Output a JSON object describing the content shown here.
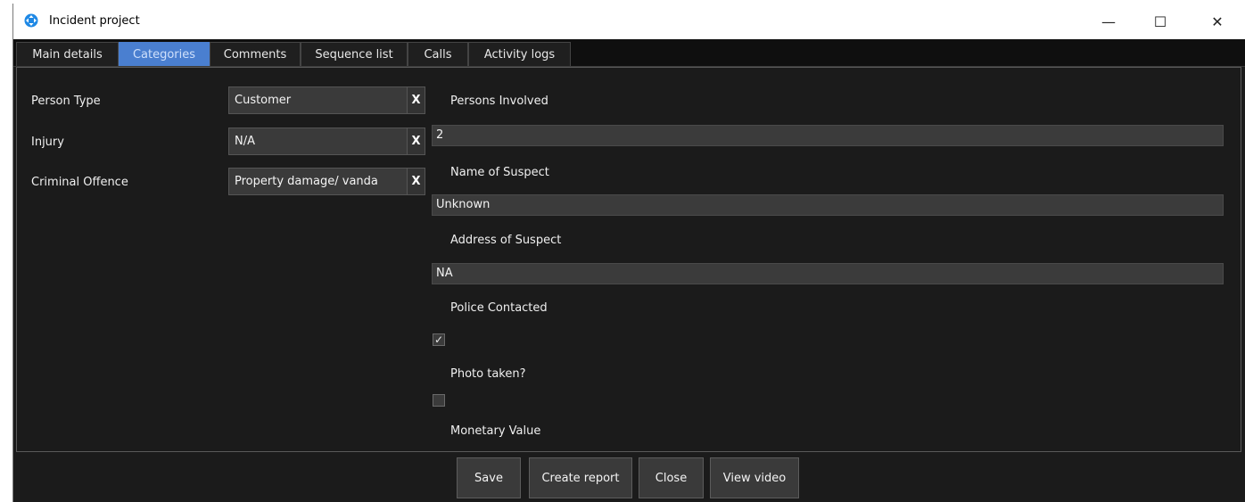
{
  "window": {
    "title": "Incident project",
    "minimize_glyph": "—",
    "maximize_glyph": "☐",
    "close_glyph": "✕",
    "icon": "app-logo-icon",
    "accent": "#4a7fd0"
  },
  "tabs": [
    {
      "label": "Main details",
      "active": false
    },
    {
      "label": "Categories",
      "active": true
    },
    {
      "label": "Comments",
      "active": false
    },
    {
      "label": "Sequence list",
      "active": false
    },
    {
      "label": "Calls",
      "active": false
    },
    {
      "label": "Activity logs",
      "active": false
    }
  ],
  "categories": [
    {
      "label": "Person Type",
      "value": "Customer",
      "clear": "X"
    },
    {
      "label": "Injury",
      "value": "N/A",
      "clear": "X"
    },
    {
      "label": "Criminal Offence",
      "value": "Property damage/ vanda",
      "clear": "X"
    }
  ],
  "fields": {
    "persons_involved": {
      "label": "Persons Involved",
      "value": "2"
    },
    "name_of_suspect": {
      "label": "Name of Suspect",
      "value": "Unknown"
    },
    "address_of_suspect": {
      "label": "Address of Suspect",
      "value": "NA"
    },
    "police_contacted": {
      "label": "Police Contacted",
      "checked": true,
      "glyph": "✓"
    },
    "photo_taken": {
      "label": "Photo taken?",
      "checked": false
    },
    "monetary_value": {
      "label": "Monetary Value"
    }
  },
  "buttons": {
    "save": "Save",
    "create_report": "Create report",
    "close": "Close",
    "view_video": "View video"
  }
}
